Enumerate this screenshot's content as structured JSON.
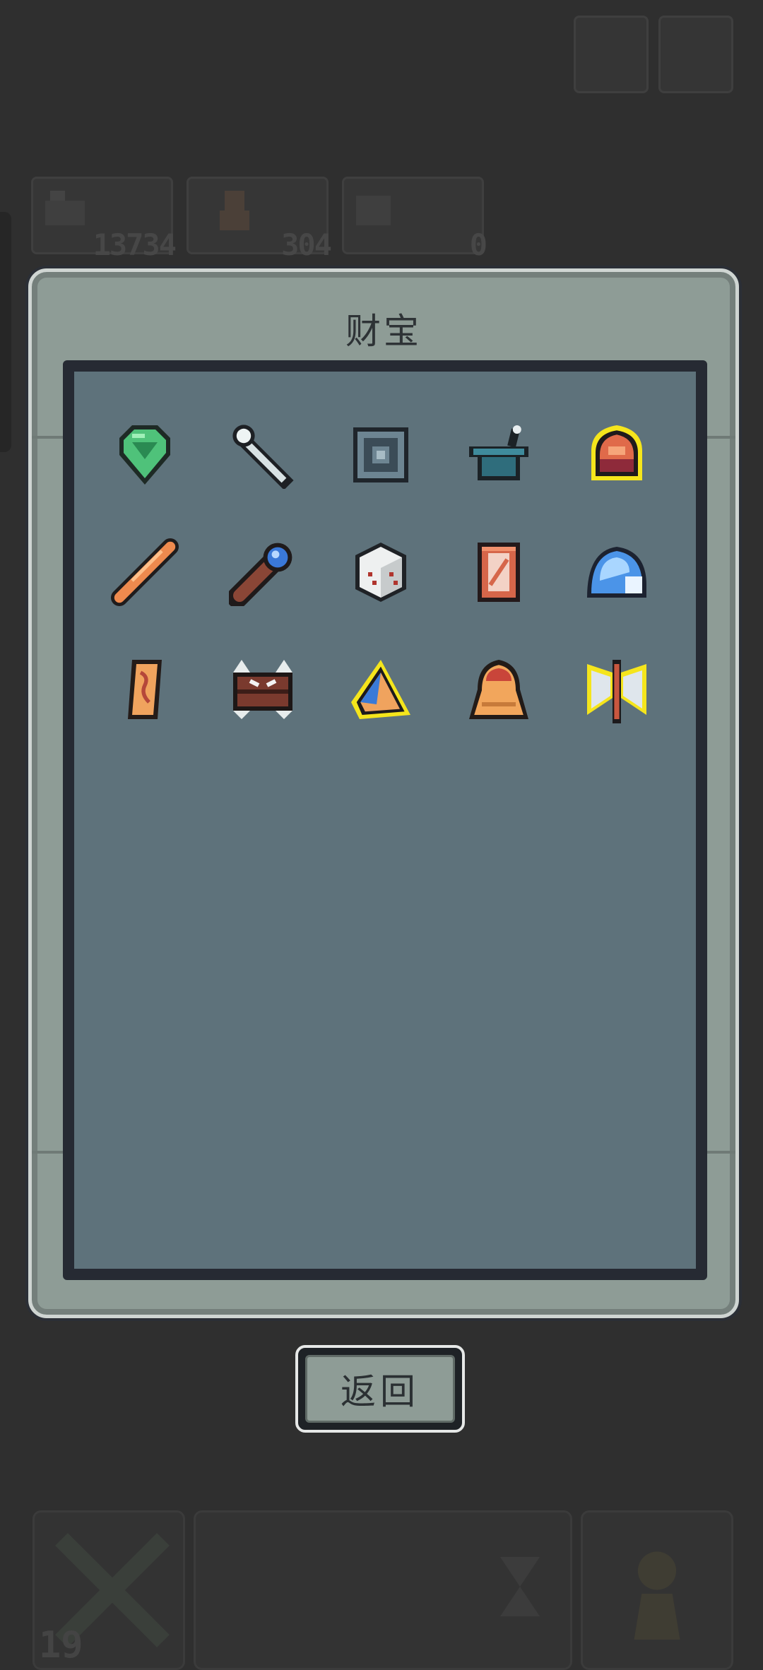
{
  "background": {
    "stats": [
      {
        "name": "gold",
        "value": "13734"
      },
      {
        "name": "hero",
        "value": "304"
      },
      {
        "name": "potion",
        "value": "0"
      }
    ],
    "level": "19"
  },
  "modal": {
    "title": "财宝",
    "items": [
      {
        "icon": "emerald-gem-icon",
        "rare": false
      },
      {
        "icon": "bone-wand-icon",
        "rare": false
      },
      {
        "icon": "stone-tablet-icon",
        "rare": false
      },
      {
        "icon": "teal-pot-icon",
        "rare": false
      },
      {
        "icon": "red-helmet-icon",
        "rare": true
      },
      {
        "icon": "orange-rod-icon",
        "rare": false
      },
      {
        "icon": "orb-scepter-icon",
        "rare": false
      },
      {
        "icon": "dice-icon",
        "rare": false
      },
      {
        "icon": "mirror-card-icon",
        "rare": false
      },
      {
        "icon": "ice-slime-icon",
        "rare": false
      },
      {
        "icon": "scroll-icon",
        "rare": false
      },
      {
        "icon": "spiked-chest-icon",
        "rare": false
      },
      {
        "icon": "crystal-shard-icon",
        "rare": true
      },
      {
        "icon": "golden-bell-icon",
        "rare": false
      },
      {
        "icon": "battle-axe-icon",
        "rare": true
      }
    ],
    "return_label": "返回"
  }
}
